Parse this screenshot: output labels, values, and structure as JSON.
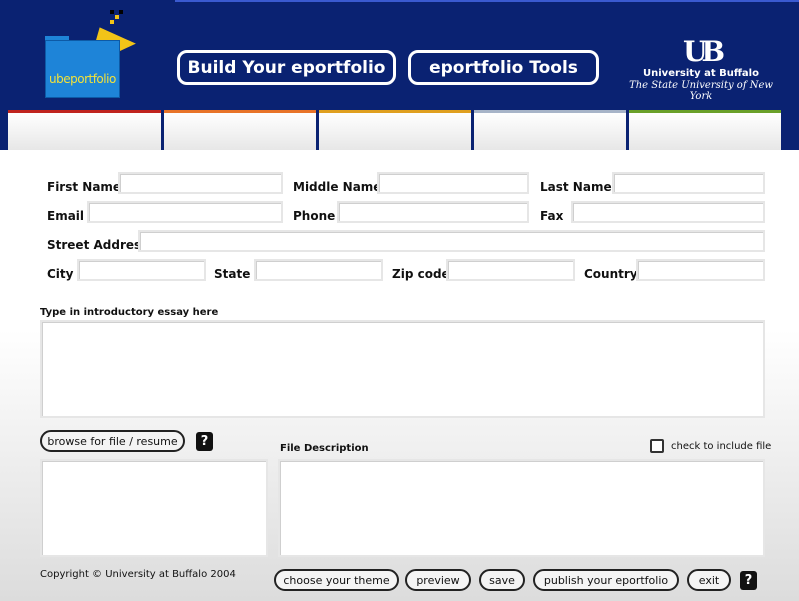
{
  "header": {
    "logo_text": "ubeportfolio",
    "build_button": "Build Your eportfolio",
    "tools_button": "eportfolio Tools",
    "ub_mark": "UB",
    "ub_line1": "University at Buffalo",
    "ub_line2": "The State University of New York"
  },
  "form": {
    "first_name_label": "First Name",
    "middle_name_label": "Middle Name",
    "last_name_label": "Last Name",
    "email_label": "Email",
    "phone_label": "Phone",
    "fax_label": "Fax",
    "street_label": "Street Address",
    "city_label": "City",
    "state_label": "State",
    "zip_label": "Zip code",
    "country_label": "Country",
    "essay_label": "Type in introductory essay here"
  },
  "file": {
    "browse_button": "browse for file / resume",
    "help": "?",
    "description_label": "File Description",
    "include_label": "check to include file"
  },
  "footer": {
    "copyright": "Copyright © University at Buffalo 2004",
    "theme_button": "choose your theme",
    "preview_button": "preview",
    "save_button": "save",
    "publish_button": "publish your eportfolio",
    "exit_button": "exit",
    "help": "?"
  },
  "colors": {
    "header_bg": "#0a2272",
    "tab1": "#c0241e",
    "tab2": "#e8742a",
    "tab3": "#e0a020",
    "tab4": "#a7b4c8",
    "tab5": "#6aa02a"
  }
}
